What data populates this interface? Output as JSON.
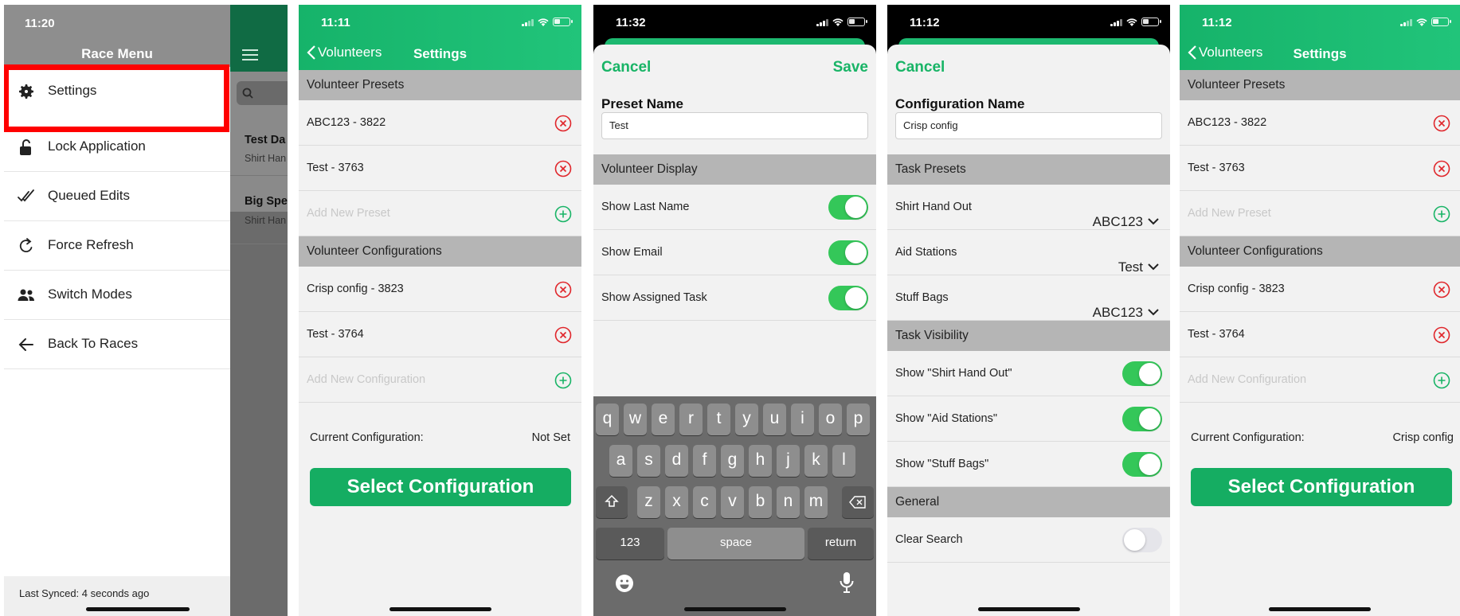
{
  "screen1": {
    "time": "11:20",
    "title": "Race Menu",
    "items": [
      {
        "label": "Settings",
        "icon": "gear-icon"
      },
      {
        "label": "Lock Application",
        "icon": "unlock-icon"
      },
      {
        "label": "Queued Edits",
        "icon": "double-check-icon"
      },
      {
        "label": "Force Refresh",
        "icon": "refresh-icon"
      },
      {
        "label": "Switch Modes",
        "icon": "people-icon"
      },
      {
        "label": "Back To Races",
        "icon": "arrow-left-icon"
      }
    ],
    "last_synced": "Last Synced: 4 seconds ago",
    "highlight_color": "#ff0000",
    "behind": {
      "race1_title": "Test Da",
      "race1_sub": "Shirt Han",
      "race2_title": "Big Spe",
      "race2_sub": "Shirt Han"
    }
  },
  "screen2": {
    "time": "11:11",
    "back_label": "Volunteers",
    "title": "Settings",
    "presets_header": "Volunteer Presets",
    "presets": [
      "ABC123 - 3822",
      "Test - 3763"
    ],
    "add_preset": "Add New Preset",
    "configs_header": "Volunteer Configurations",
    "configs": [
      "Crisp config - 3823",
      "Test - 3764"
    ],
    "add_config": "Add New Configuration",
    "current_label": "Current Configuration:",
    "current_value": "Not Set",
    "select_button": "Select Configuration"
  },
  "screen3": {
    "time": "11:32",
    "cancel": "Cancel",
    "save": "Save",
    "field_label": "Preset Name",
    "field_value": "Test",
    "section": "Volunteer Display",
    "toggles": [
      {
        "label": "Show Last Name",
        "on": true
      },
      {
        "label": "Show Email",
        "on": true
      },
      {
        "label": "Show Assigned Task",
        "on": true
      }
    ],
    "keyboard": {
      "row1": [
        "q",
        "w",
        "e",
        "r",
        "t",
        "y",
        "u",
        "i",
        "o",
        "p"
      ],
      "row2": [
        "a",
        "s",
        "d",
        "f",
        "g",
        "h",
        "j",
        "k",
        "l"
      ],
      "row3": [
        "z",
        "x",
        "c",
        "v",
        "b",
        "n",
        "m"
      ],
      "num": "123",
      "space": "space",
      "return": "return"
    }
  },
  "screen4": {
    "time": "11:12",
    "cancel": "Cancel",
    "field_label": "Configuration Name",
    "field_value": "Crisp config",
    "task_presets_header": "Task Presets",
    "task_presets": [
      {
        "label": "Shirt Hand Out",
        "value": "ABC123"
      },
      {
        "label": "Aid Stations",
        "value": "Test"
      },
      {
        "label": "Stuff Bags",
        "value": "ABC123"
      }
    ],
    "visibility_header": "Task Visibility",
    "visibility": [
      {
        "label": "Show \"Shirt Hand Out\"",
        "on": true
      },
      {
        "label": "Show \"Aid Stations\"",
        "on": true
      },
      {
        "label": "Show \"Stuff Bags\"",
        "on": true
      }
    ],
    "general_header": "General",
    "general": [
      {
        "label": "Clear Search",
        "on": false
      }
    ]
  },
  "screen5": {
    "time": "11:12",
    "back_label": "Volunteers",
    "title": "Settings",
    "presets_header": "Volunteer Presets",
    "presets": [
      "ABC123 - 3822",
      "Test - 3763"
    ],
    "add_preset": "Add New Preset",
    "configs_header": "Volunteer Configurations",
    "configs": [
      "Crisp config - 3823",
      "Test - 3764"
    ],
    "add_config": "Add New Configuration",
    "current_label": "Current Configuration:",
    "current_value": "Crisp config",
    "select_button": "Select Configuration"
  },
  "colors": {
    "brand_green": "#18b466",
    "delete_red": "#e0262b"
  }
}
